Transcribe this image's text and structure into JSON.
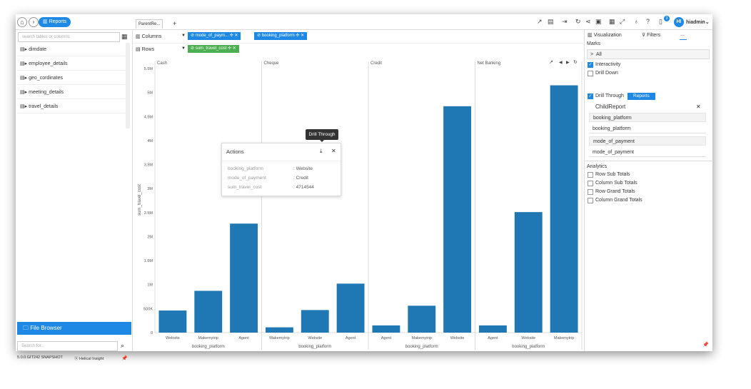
{
  "topbar": {
    "reports_label": "Reports",
    "tab_label": "ParentRe...",
    "tab_add": "+",
    "avatar_initials": "HI",
    "user_name": "hiadmin",
    "notification_count": "3"
  },
  "left": {
    "search_placeholder": "search tables or columns",
    "datasets": [
      "dimdate",
      "employee_details",
      "geo_cordinates",
      "meeting_details",
      "travel_details"
    ],
    "file_browser_label": "File Browser",
    "search2_placeholder": "Search for...",
    "version": "5.0.0.GIT242 SNAPSHOT",
    "brand": "Helical Insight"
  },
  "shelf": {
    "columns_label": "Columns",
    "rows_label": "Rows",
    "column_pills": [
      "mode_of_paym...",
      "booking_platform"
    ],
    "row_pills": [
      "sum_travel_cost"
    ]
  },
  "right": {
    "tab_visualization": "Visualization",
    "tab_filters": "Filters",
    "tab_more": "...",
    "marks_label": "Marks",
    "all_label": "All",
    "interactivity_label": "Interactivity",
    "drilldown_label": "Drill Down",
    "drillthrough_label": "Drill Through",
    "reports_button": "Reports",
    "child_report_title": "ChildReport",
    "child_fields": [
      {
        "grey": "booking_platform",
        "white": "booking_platform"
      },
      {
        "grey": "mode_of_payment",
        "white": "mode_of_payment"
      }
    ],
    "analytics_label": "Analytics",
    "analytics_items": [
      "Row Sub Totals",
      "Column Sub Totals",
      "Row Grand Totals",
      "Column Grand Totals"
    ]
  },
  "popup": {
    "title": "Actions",
    "rows": [
      {
        "k": "booking_platform",
        "v": ": Website"
      },
      {
        "k": "mode_of_payment",
        "v": ": Credit"
      },
      {
        "k": "sum_travel_cost",
        "v": ": 4714544"
      }
    ],
    "tooltip": "Drill Through"
  },
  "chart_data": {
    "type": "bar",
    "ylabel": "sum_travel_cost",
    "xlabel": "booking_platform",
    "ylim": [
      0,
      5500000
    ],
    "yticks": [
      {
        "v": 0,
        "label": "0"
      },
      {
        "v": 500000,
        "label": "500K"
      },
      {
        "v": 1000000,
        "label": "1M"
      },
      {
        "v": 1500000,
        "label": "1.5M"
      },
      {
        "v": 2000000,
        "label": "2M"
      },
      {
        "v": 2500000,
        "label": "2.5M"
      },
      {
        "v": 3000000,
        "label": "3M"
      },
      {
        "v": 3500000,
        "label": "3.5M"
      },
      {
        "v": 4000000,
        "label": "4M"
      },
      {
        "v": 4500000,
        "label": "4.5M"
      },
      {
        "v": 5000000,
        "label": "5M"
      },
      {
        "v": 5500000,
        "label": "5.5M"
      }
    ],
    "color": "#1f77b4",
    "panels": [
      {
        "name": "Cash",
        "categories": [
          "Website",
          "Makemytrip",
          "Agent"
        ],
        "values": [
          460000,
          870000,
          2270000
        ]
      },
      {
        "name": "Cheque",
        "categories": [
          "Makemytrip",
          "Website",
          "Agent"
        ],
        "values": [
          110000,
          470000,
          1020000
        ]
      },
      {
        "name": "Credit",
        "categories": [
          "Agent",
          "Makemytrip",
          "Website"
        ],
        "values": [
          150000,
          560000,
          4714544
        ]
      },
      {
        "name": "Net Banking",
        "categories": [
          "Agent",
          "Website",
          "Makemytrip"
        ],
        "values": [
          150000,
          2510000,
          5150000
        ]
      }
    ]
  }
}
